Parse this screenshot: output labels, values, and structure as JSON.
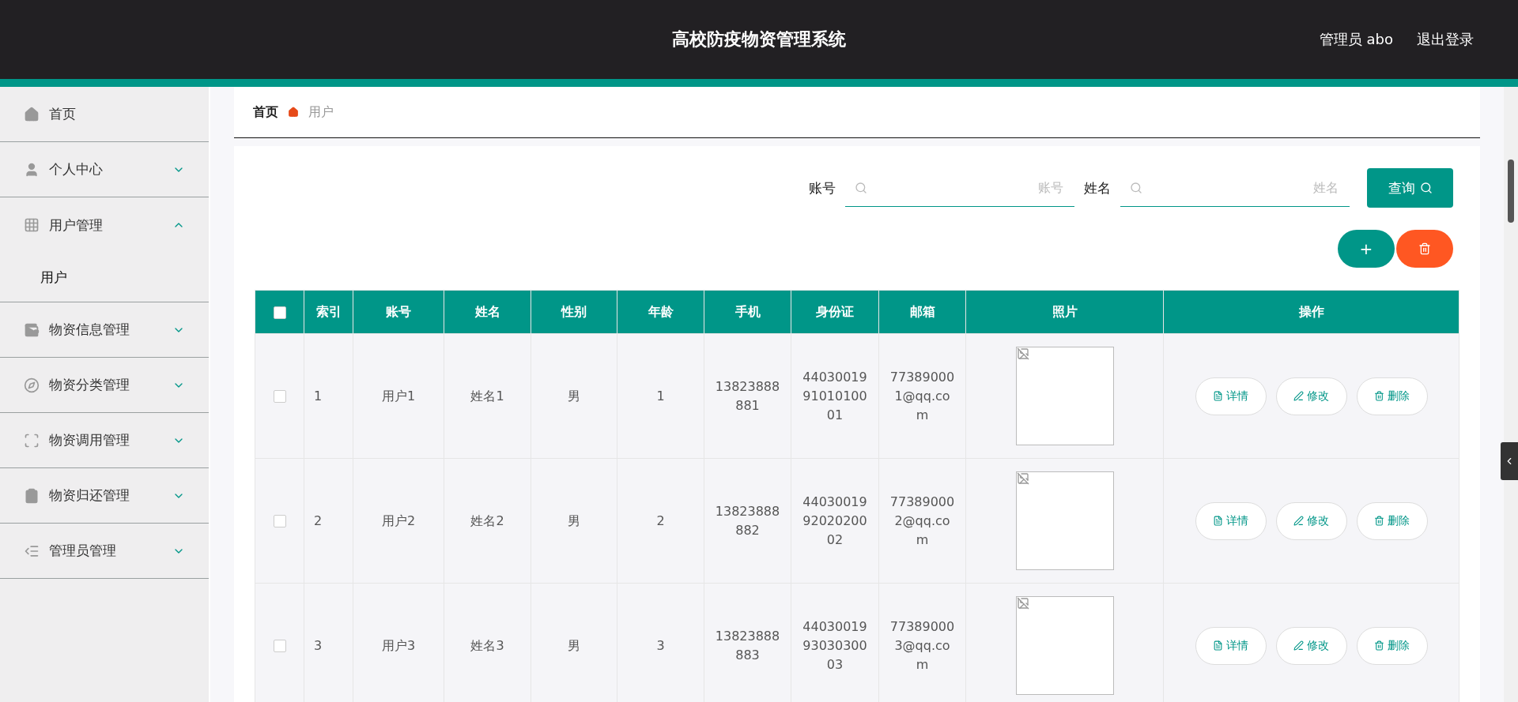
{
  "header": {
    "title": "高校防疫物资管理系统",
    "user": "管理员 abo",
    "logout": "退出登录"
  },
  "sidebar": {
    "items": [
      {
        "kind": "home",
        "label": "首页",
        "selected": false
      },
      {
        "kind": "user",
        "label": "个人中心",
        "expanded": false,
        "selected": false
      },
      {
        "kind": "grid",
        "label": "用户管理",
        "expanded": true,
        "selected": false,
        "children": [
          {
            "label": "用户",
            "selected": true
          }
        ]
      },
      {
        "kind": "wallet",
        "label": "物资信息管理",
        "expanded": false,
        "selected": false
      },
      {
        "kind": "compass",
        "label": "物资分类管理",
        "expanded": false,
        "selected": false
      },
      {
        "kind": "scan",
        "label": "物资调用管理",
        "expanded": false,
        "selected": false
      },
      {
        "kind": "clipboard",
        "label": "物资归还管理",
        "expanded": false,
        "selected": false
      },
      {
        "kind": "list",
        "label": "管理员管理",
        "expanded": false,
        "selected": false
      }
    ]
  },
  "breadcrumb": [
    "首页",
    "用户"
  ],
  "search": {
    "fields": [
      {
        "label": "账号",
        "placeholder": "账号"
      },
      {
        "label": "姓名",
        "placeholder": "姓名"
      }
    ],
    "button": "查询"
  },
  "actions": [
    {
      "kind": "add",
      "label": "+"
    },
    {
      "kind": "delete"
    }
  ],
  "table": {
    "select_all": {
      "checked": false
    },
    "columns": [
      "索引",
      "账号",
      "姓名",
      "性别",
      "年龄",
      "手机",
      "身份证",
      "邮箱",
      "照片",
      "操作"
    ],
    "rows": [
      {
        "checked": false,
        "cells": [
          "1",
          "用户1",
          "姓名1",
          "男",
          "1",
          "13823888881",
          "440300199101010001",
          "773890001@qq.com"
        ],
        "buttons": [
          "详情",
          "修改",
          "删除"
        ]
      },
      {
        "checked": false,
        "cells": [
          "2",
          "用户2",
          "姓名2",
          "男",
          "2",
          "13823888882",
          "440300199202020002",
          "773890002@qq.com"
        ],
        "buttons": [
          "详情",
          "修改",
          "删除"
        ]
      },
      {
        "checked": false,
        "cells": [
          "3",
          "用户3",
          "姓名3",
          "男",
          "3",
          "13823888883",
          "440300199303030003",
          "773890003@qq.com"
        ],
        "buttons": [
          "详情",
          "修改",
          "删除"
        ]
      }
    ]
  }
}
